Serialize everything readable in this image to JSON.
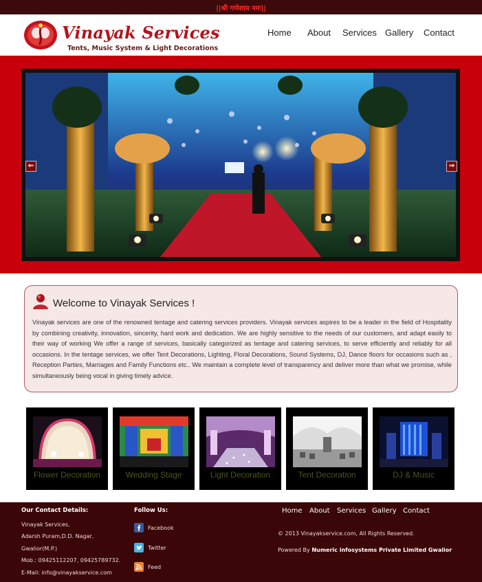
{
  "topbar": {
    "text": "||श्री गणेशाय नमः||"
  },
  "brand": {
    "title": "Vinayak Services",
    "subtitle": "Tents, Music System & Light Decorations",
    "color": "#b5121b"
  },
  "nav": [
    "Home",
    "About",
    "Services",
    "Gallery",
    "Contact"
  ],
  "slider": {
    "prev_symbol": "⇐",
    "next_symbol": "⇒"
  },
  "welcome": {
    "icon": "user-icon",
    "title": "Welcome to Vinayak Services !",
    "body": "Vinayak services are one of the renowned tentage and catering services providers. Vinayak services aspires to be a leader in the field of Hospitality by combining creativity, innovation, sincerity, hard work and dedication. We are highly sensitive to the needs of our customers, and adapt easily to their way of working We offer a range of services, basically categorized as tentage and catering services, to serve efficiently and reliably for all occasions. In the tentage services, we offer Tent Decorations, Lighting, Floral Decorations, Sound Systems, DJ, Dance floors for occasions such as , Reception Parties, Marriages and Family Functions etc.. We maintain a complete level of transparency and deliver more than what we promise, while simultaneously being vocal in giving timely advice."
  },
  "services": [
    {
      "label": "Flower Decoration"
    },
    {
      "label": "Wedding Stage"
    },
    {
      "label": "Light Decoration"
    },
    {
      "label": "Tent Decoration"
    },
    {
      "label": "DJ & Music"
    }
  ],
  "footer": {
    "contact_heading": "Our Contact Details:",
    "contact_lines": [
      "Vinayak Services,",
      "Adarsh Puram,D.D. Nagar,",
      "Gwalior(M.P.)",
      "Mob.: 09425112207, 09425789732.",
      "E-Mail: info@vinayakservice.com"
    ],
    "follow_heading": "Follow Us:",
    "social": [
      {
        "label": "Facebook",
        "icon": "facebook-icon"
      },
      {
        "label": "Twitter",
        "icon": "twitter-icon"
      },
      {
        "label": "Feed",
        "icon": "rss-feed-icon"
      }
    ],
    "nav": [
      "Home",
      "About",
      "Services",
      "Gallery",
      "Contact"
    ],
    "copyright": "© 2013 Vinayakservice.com, All Rights Reserved.",
    "powered_prefix": "Powered By",
    "powered_company": "Numeric infosystems Private Limited Gwalior"
  },
  "colors": {
    "topbar": "#3d0a0b",
    "banner": "#c8000c",
    "footer": "#3a0607",
    "welcome_bg": "#f6e8e6",
    "caption": "#4c5321"
  }
}
